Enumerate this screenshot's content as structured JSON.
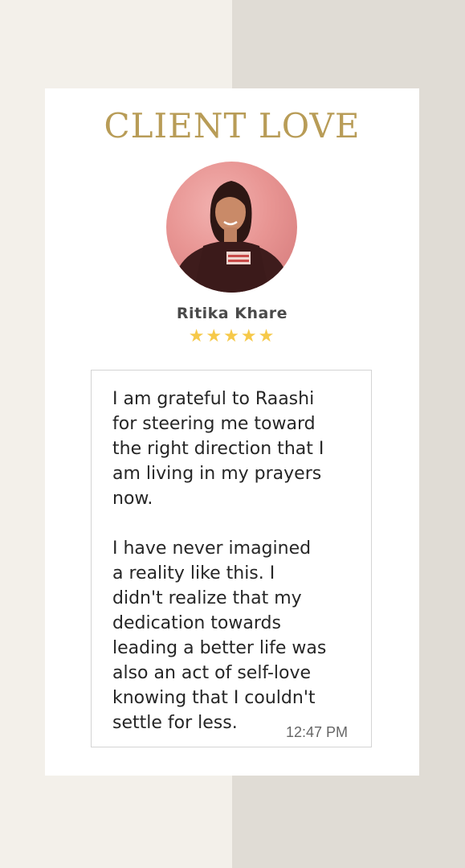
{
  "card": {
    "title": "CLIENT LOVE",
    "reviewer_name": "Ritika Khare",
    "rating_stars": "★★★★★",
    "rating": 5
  },
  "testimonial": {
    "paragraphs": [
      {
        "lines": [
          "I am grateful to Raashi",
          "for steering me toward",
          "the right direction that I",
          "am living in my prayers",
          "now."
        ]
      },
      {
        "lines": [
          "I have never imagined",
          "a reality like this. I",
          "didn't realize that my",
          "dedication towards",
          "leading a better life was",
          "also an act of self-love",
          "knowing that I couldn't",
          "settle for less."
        ]
      }
    ],
    "timestamp": "12:47 PM"
  },
  "colors": {
    "background_left": "#f3f0ea",
    "background_right": "#e0dcd5",
    "card": "#ffffff",
    "title_gold": "#b89c57",
    "star_yellow": "#f6c94a",
    "text_dark": "#262626"
  }
}
